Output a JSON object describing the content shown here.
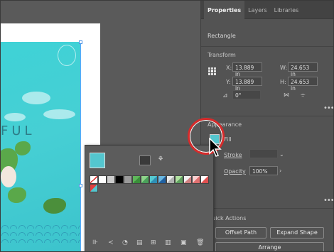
{
  "panel": {
    "tabs": [
      {
        "label": "Properties"
      },
      {
        "label": "Layers"
      },
      {
        "label": "Libraries"
      }
    ],
    "object_type": "Rectangle",
    "transform": {
      "heading": "Transform",
      "x_label": "X:",
      "x_value": "13.889 in",
      "y_label": "Y:",
      "y_value": "13.889 in",
      "w_label": "W:",
      "w_value": "24.653 in",
      "h_label": "H:",
      "h_value": "24.653 in",
      "angle_value": "0°"
    },
    "appearance": {
      "heading": "Appearance",
      "fill_label": "Fill",
      "stroke_label": "Stroke",
      "opacity_label": "Opacity",
      "opacity_value": "100%"
    },
    "quick_actions": {
      "heading": "Quick Actions",
      "offset_path": "Offset Path",
      "expand_shape": "Expand Shape",
      "arrange": "Arrange"
    }
  },
  "artwork": {
    "text": "FUL"
  },
  "swatches": {
    "current_color": "#54c6cf",
    "colors": [
      "#ffffff",
      "#d0d0d0",
      "#000000",
      "#e03030",
      "#f0a030",
      "#f0e040",
      "#60c040",
      "#30a060",
      "#30b0c0",
      "#3070d0",
      "#6040c0",
      "#c040a0",
      "#e06080",
      "#a0e0f0"
    ]
  }
}
